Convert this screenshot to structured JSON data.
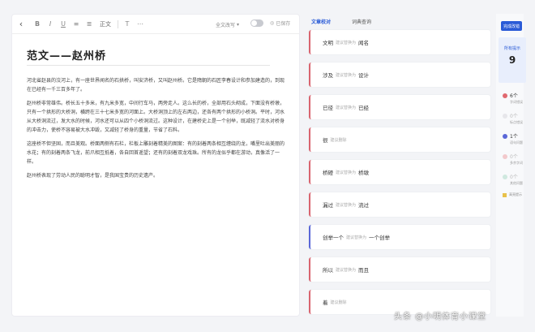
{
  "toolbar": {
    "back_icon": "chevron-left-icon",
    "buttons": [
      "B",
      "I",
      "U",
      "≡",
      "≣"
    ],
    "font_label": "正文",
    "font_size_icon": "text-size-icon",
    "more_icon": "more-icon"
  },
  "mode": {
    "label": "全文改写"
  },
  "status": {
    "saved_label": "已保存"
  },
  "document": {
    "title": "范文——赵州桥",
    "paragraphs": [
      "河北省赵县的洨河上，有一座世界闻名的石拱桥，叫安济桥，又叫赵州桥。它是隋朝的石匠李春设计和参加建造的，到现在已经有一千三百多年了。",
      "赵州桥非常雄伟。桥长五十多米，有九米多宽，中间行车马，两旁走人。这么长的桥，全部用石头砌成，下面没有桥墩，只有一个拱形的大桥洞，横跨在三十七米多宽的河面上。大桥洞顶上的左右两边，还各有两个拱形的小桥洞。平时，河水从大桥洞流过，发大水的时候，河水还可以从四个小桥洞流过。这种设计，在建桥史上是一个创举，既减轻了流水对桥身的冲击力，使桥不容易被大水冲毁，又减轻了桥身的重量，节省了石料。",
      "这座桥不但坚固，而且美观。桥面两侧有石栏，栏板上雕刻着精美的图案：有的刻着两条相互缠绕的龙，嘴里吐出美丽的水花；有的刻着两条飞龙，前爪相互抵着，各自回首遥望；还有的刻着双龙戏珠。所有的龙似乎都在游动，真像活了一样。",
      "赵州桥表现了劳动人民的聪明才智，是我国宝贵的历史遗产。"
    ]
  },
  "review": {
    "tabs": [
      "文章校对",
      "词典查询"
    ],
    "active_tab": 0,
    "cards": [
      {
        "original": "文明",
        "hint": "建议替换为",
        "suggestion": "闻名"
      },
      {
        "original": "涉及",
        "hint": "建议替换为",
        "suggestion": "设计"
      },
      {
        "original": "已径",
        "hint": "建议替换为",
        "suggestion": "已经"
      },
      {
        "original": "很",
        "hint": "建议删除",
        "suggestion": ""
      },
      {
        "original": "桥磴",
        "hint": "建议替换为",
        "suggestion": "桥墩"
      },
      {
        "original": "漏过",
        "hint": "建议替换为",
        "suggestion": "流过"
      },
      {
        "original": "创举一个",
        "hint": "建议替换为",
        "suggestion": "一个创举"
      },
      {
        "original": "所以",
        "hint": "建议替换为",
        "suggestion": "而且"
      },
      {
        "original": "着",
        "hint": "建议删除",
        "suggestion": ""
      }
    ]
  },
  "sidebar": {
    "submit_label": "完成改错",
    "issues_label": "所有提示",
    "issues_count": "9",
    "categories": [
      {
        "count": "6个",
        "name": "字词错误",
        "color": "#e0686f"
      },
      {
        "count": "0个",
        "name": "标点错误",
        "color": "#e6e6ea"
      },
      {
        "count": "1个",
        "name": "语句问题",
        "color": "#5a67d8"
      },
      {
        "count": "0个",
        "name": "多余字词",
        "color": "#f2c9cc"
      },
      {
        "count": "0个",
        "name": "其他问题",
        "color": "#cfe8df"
      }
    ],
    "highlight_label": "高亮提示"
  },
  "watermark": "头条 @小明体育小课堂"
}
